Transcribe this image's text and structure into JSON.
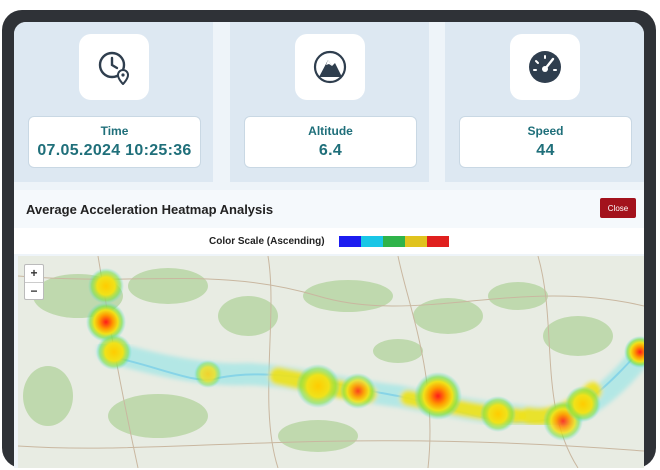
{
  "cards": [
    {
      "label": "Time",
      "value": "07.05.2024 10:25:36",
      "icon": "clock-location-icon"
    },
    {
      "label": "Altitude",
      "value": "6.4",
      "icon": "mountain-icon"
    },
    {
      "label": "Speed",
      "value": "44",
      "icon": "speedometer-icon"
    }
  ],
  "heatmap": {
    "title": "Average Acceleration Heatmap Analysis",
    "close_label": "Close",
    "scale_label": "Color Scale (Ascending)",
    "scale_colors": [
      "#1c1cf0",
      "#19c6e6",
      "#2fb34a",
      "#e0c31e",
      "#e0201e"
    ]
  },
  "map": {
    "zoom_in": "+",
    "zoom_out": "−"
  }
}
